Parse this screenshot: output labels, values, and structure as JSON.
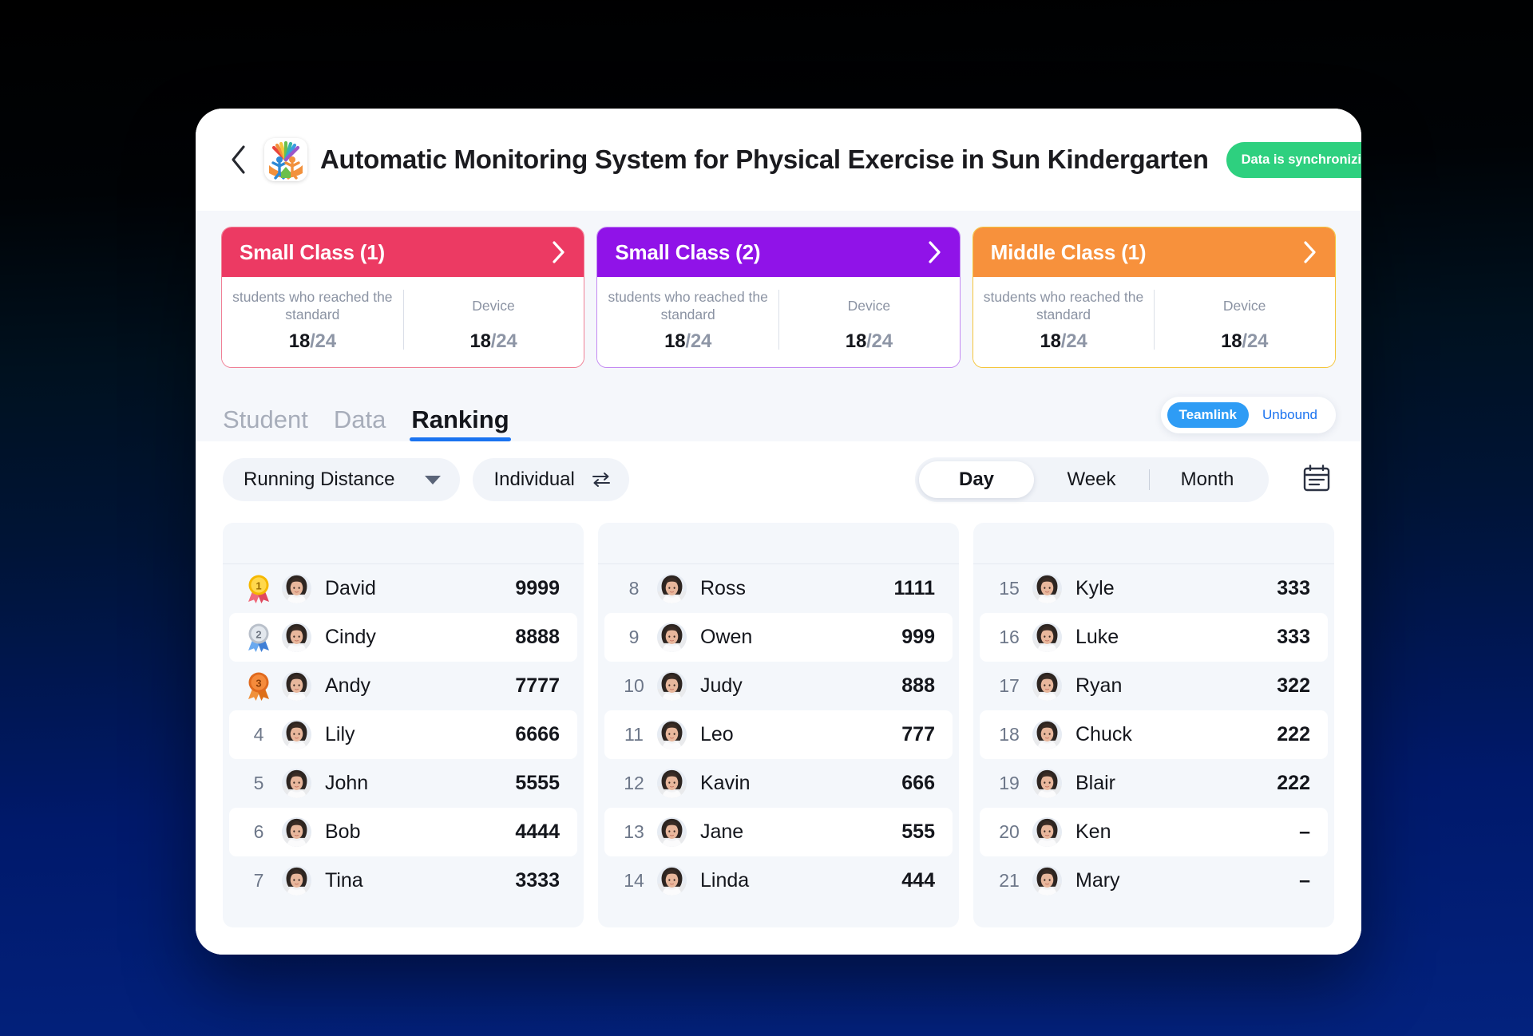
{
  "header": {
    "back_icon": "chevron-left-icon",
    "logo_icon": "kindergarten-logo-icon",
    "title": "Automatic Monitoring System for Physical Exercise in Sun Kindergarten",
    "sync_label": "Data is synchronizing…",
    "sync_icon": "refresh-icon",
    "sync_color": "#2ed07f",
    "gear_icon": "gear-icon",
    "caret_icon": "caret-down-icon"
  },
  "cards": [
    {
      "title": "Small Class (1)",
      "color": "#ec3a63",
      "border": "#f07f95",
      "chevron_icon": "chevron-right-icon",
      "stats": [
        {
          "label": "students who reached the standard",
          "value": "18",
          "total": "/24"
        },
        {
          "label": "Device",
          "value": "18",
          "total": "/24"
        }
      ]
    },
    {
      "title": "Small Class (2)",
      "color": "#9013e8",
      "border": "#c389f2",
      "chevron_icon": "chevron-right-icon",
      "stats": [
        {
          "label": "students who reached the standard",
          "value": "18",
          "total": "/24"
        },
        {
          "label": "Device",
          "value": "18",
          "total": "/24"
        }
      ]
    },
    {
      "title": "Middle Class (1)",
      "color": "#f7913c",
      "border": "#f5c53b",
      "chevron_icon": "chevron-right-icon",
      "stats": [
        {
          "label": "students who reached the standard",
          "value": "18",
          "total": "/24"
        },
        {
          "label": "Device",
          "value": "18",
          "total": "/24"
        }
      ]
    }
  ],
  "tabs": [
    {
      "label": "Student",
      "active": false
    },
    {
      "label": "Data",
      "active": false
    },
    {
      "label": "Ranking",
      "active": true
    }
  ],
  "teamlink_toggle": {
    "options": [
      {
        "label": "Teamlink",
        "active": true
      },
      {
        "label": "Unbound",
        "active": false
      }
    ],
    "active_color": "#2e9cf5"
  },
  "filters": {
    "metric": {
      "value": "Running Distance",
      "icon": "caret-down-icon"
    },
    "mode": {
      "value": "Individual",
      "icon": "swap-arrows-icon"
    },
    "periods": [
      {
        "label": "Day",
        "active": true
      },
      {
        "label": "Week",
        "active": false
      },
      {
        "label": "Month",
        "active": false
      }
    ],
    "calendar_icon": "calendar-icon"
  },
  "ranking": {
    "accent": "#1a73f0",
    "columns": [
      {
        "rows": [
          {
            "rank": "1",
            "medal": "gold",
            "name": "David",
            "score": "9999"
          },
          {
            "rank": "2",
            "medal": "silver",
            "name": "Cindy",
            "score": "8888"
          },
          {
            "rank": "3",
            "medal": "bronze",
            "name": "Andy",
            "score": "7777"
          },
          {
            "rank": "4",
            "medal": "",
            "name": "Lily",
            "score": "6666"
          },
          {
            "rank": "5",
            "medal": "",
            "name": "John",
            "score": "5555"
          },
          {
            "rank": "6",
            "medal": "",
            "name": "Bob",
            "score": "4444"
          },
          {
            "rank": "7",
            "medal": "",
            "name": "Tina",
            "score": "3333"
          }
        ]
      },
      {
        "rows": [
          {
            "rank": "8",
            "medal": "",
            "name": "Ross",
            "score": "1111"
          },
          {
            "rank": "9",
            "medal": "",
            "name": "Owen",
            "score": "999"
          },
          {
            "rank": "10",
            "medal": "",
            "name": "Judy",
            "score": "888"
          },
          {
            "rank": "11",
            "medal": "",
            "name": "Leo",
            "score": "777"
          },
          {
            "rank": "12",
            "medal": "",
            "name": "Kavin",
            "score": "666"
          },
          {
            "rank": "13",
            "medal": "",
            "name": "Jane",
            "score": "555"
          },
          {
            "rank": "14",
            "medal": "",
            "name": "Linda",
            "score": "444"
          }
        ]
      },
      {
        "rows": [
          {
            "rank": "15",
            "medal": "",
            "name": "Kyle",
            "score": "333"
          },
          {
            "rank": "16",
            "medal": "",
            "name": "Luke",
            "score": "333"
          },
          {
            "rank": "17",
            "medal": "",
            "name": "Ryan",
            "score": "322"
          },
          {
            "rank": "18",
            "medal": "",
            "name": "Chuck",
            "score": "222"
          },
          {
            "rank": "19",
            "medal": "",
            "name": "Blair",
            "score": "222"
          },
          {
            "rank": "20",
            "medal": "",
            "name": "Ken",
            "score": "–"
          },
          {
            "rank": "21",
            "medal": "",
            "name": "Mary",
            "score": "–"
          }
        ]
      }
    ]
  }
}
